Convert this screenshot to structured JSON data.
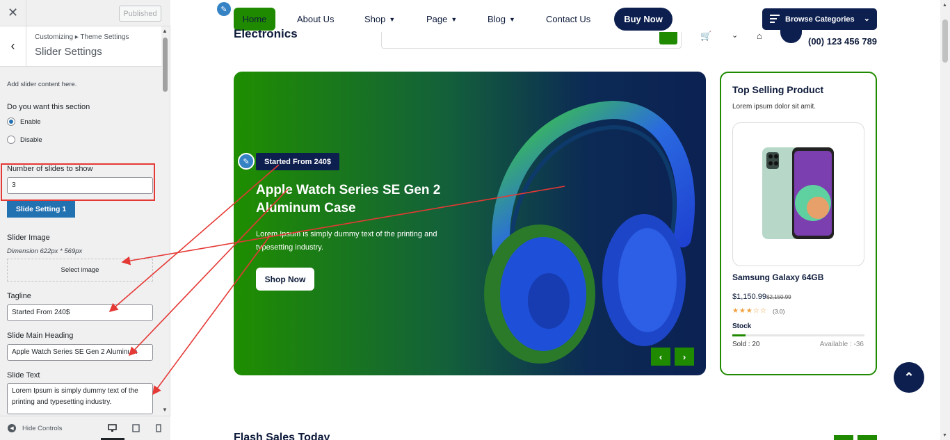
{
  "customizer": {
    "published_label": "Published",
    "breadcrumb": "Customizing ▸ Theme Settings",
    "section_title": "Slider Settings",
    "intro": "Add slider content here.",
    "section_question": "Do you want this section",
    "radio_enable": "Enable",
    "radio_disable": "Disable",
    "slides_count_label": "Number of slides to show",
    "slides_count_value": "3",
    "slide_setting_tab": "Slide Setting 1",
    "slider_image_label": "Slider Image",
    "dimension_note": "Dimension 622px * 569px",
    "select_image_label": "Select image",
    "tagline_label": "Tagline",
    "tagline_value": "Started From 240$",
    "heading_label": "Slide Main Heading",
    "heading_value": "Apple Watch Series SE Gen 2 Aluminum",
    "text_label": "Slide Text",
    "text_value": "Lorem Ipsum is simply dummy text of the printing and typesetting industry.",
    "hide_controls": "Hide Controls"
  },
  "site": {
    "nav": [
      "Home",
      "About Us",
      "Shop",
      "Page",
      "Blog",
      "Contact Us"
    ],
    "buy_now": "Buy Now",
    "browse_categories": "Browse Categories",
    "logo_text": "Electronics",
    "phone": "(00) 123 456 789",
    "hero": {
      "tagline": "Started From 240$",
      "heading": "Apple Watch Series SE Gen 2 Aluminum Case",
      "text": "Lorem Ipsum is simply dummy text of the printing and typesetting industry.",
      "button": "Shop Now"
    },
    "top_selling": {
      "title": "Top Selling Product",
      "subtitle": "Lorem ipsum dolor sit amit.",
      "product_name": "Samsung Galaxy 64GB",
      "price": "$1,150.99",
      "old_price": "$2,150.99",
      "rating": 3,
      "rating_text": "(3.0)",
      "stock_label": "Stock",
      "stock_fraction": 0.1,
      "sold": "Sold : 20",
      "available": "Available : -36"
    },
    "flash_title": "Flash Sales Today"
  },
  "colors": {
    "brand_green": "#1f8a00",
    "brand_navy": "#0d1f4f",
    "wp_blue": "#2271b1",
    "annotation_red": "#e53935"
  }
}
